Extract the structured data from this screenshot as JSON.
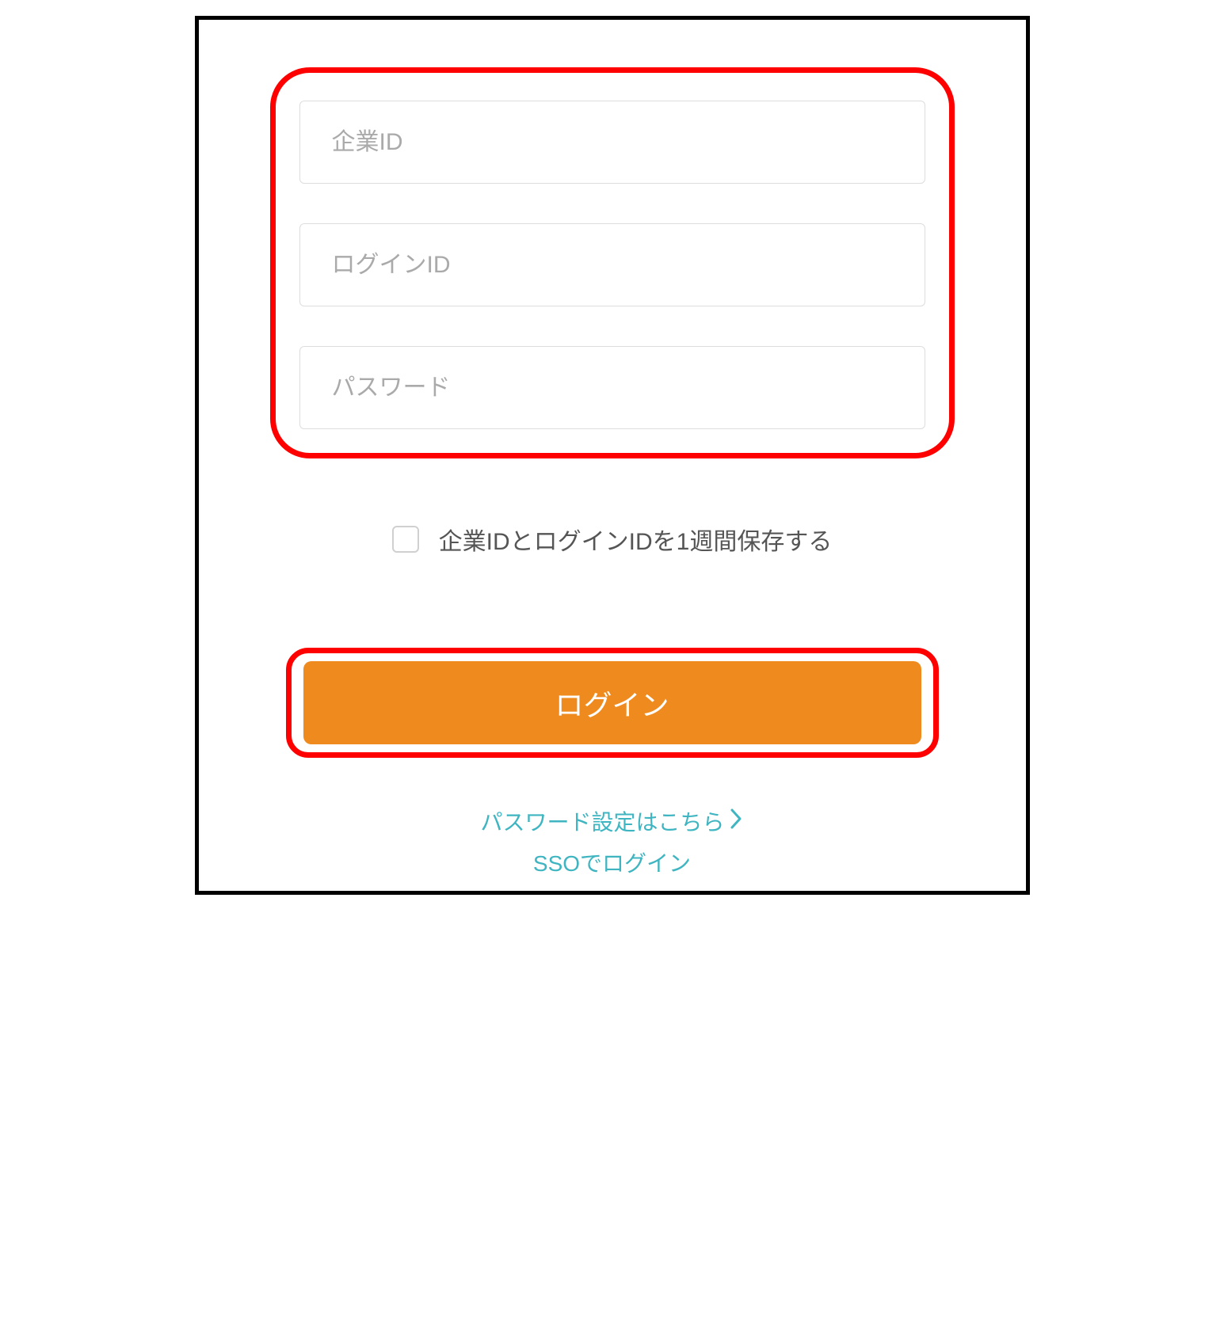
{
  "form": {
    "company_id": {
      "placeholder": "企業ID",
      "value": ""
    },
    "login_id": {
      "placeholder": "ログインID",
      "value": ""
    },
    "password": {
      "placeholder": "パスワード",
      "value": ""
    },
    "remember_label": "企業IDとログインIDを1週間保存する",
    "login_button_label": "ログイン"
  },
  "links": {
    "password_settings": "パスワード設定はこちら",
    "sso_login": "SSOでログイン"
  }
}
